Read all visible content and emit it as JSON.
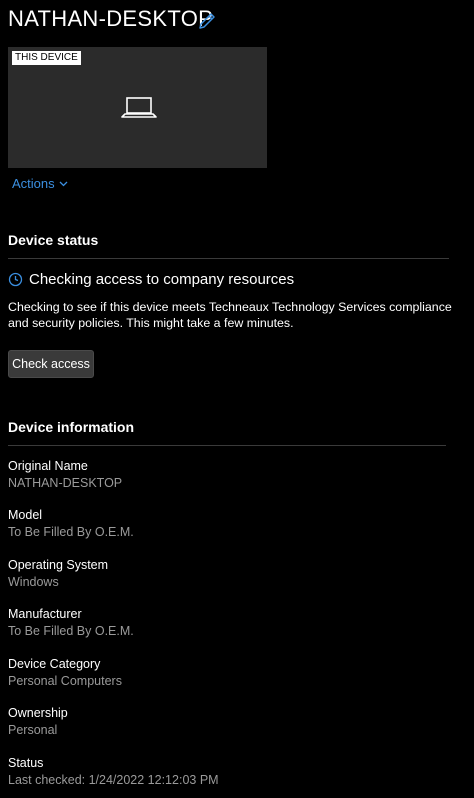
{
  "device": {
    "name": "NATHAN-DESKTOP",
    "badge": "THIS DEVICE",
    "actions_label": "Actions",
    "edit_icon": "pencil-icon",
    "tile_icon": "laptop-icon"
  },
  "device_status": {
    "title": "Device status",
    "status_icon": "clock-icon",
    "heading": "Checking access to company resources",
    "description": "Checking to see if this device meets Techneaux Technology Services compliance and security policies. This might take a few minutes.",
    "button_label": "Check access"
  },
  "device_information": {
    "title": "Device information",
    "items": [
      {
        "label": "Original Name",
        "value": "NATHAN-DESKTOP"
      },
      {
        "label": "Model",
        "value": "To Be Filled By O.E.M."
      },
      {
        "label": "Operating System",
        "value": "Windows"
      },
      {
        "label": "Manufacturer",
        "value": "To Be Filled By O.E.M."
      },
      {
        "label": "Device Category",
        "value": "Personal Computers"
      },
      {
        "label": "Ownership",
        "value": "Personal"
      },
      {
        "label": "Status",
        "value": "Last checked: 1/24/2022 12:12:03 PM"
      }
    ]
  },
  "colors": {
    "background": "#000000",
    "accent": "#3b8fe0",
    "tile": "#2b2b2b",
    "muted_text": "#9a9a9a",
    "button": "#3a3a3a"
  }
}
